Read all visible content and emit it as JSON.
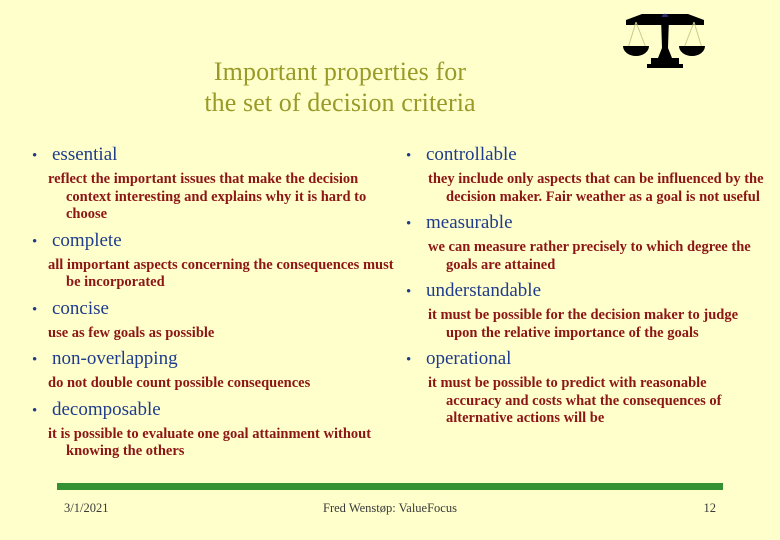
{
  "slide": {
    "background_color": "#ffffcc",
    "title_color": "#9a9a29",
    "heading_color": "#1f3c8c",
    "subtext_color": "#8c1616",
    "rule_color": "#339133",
    "title_line_1": "Important properties for",
    "title_line_2": "the set of decision criteria"
  },
  "icon": {
    "name": "balance-scale-icon",
    "color": "#000000"
  },
  "left_column": [
    {
      "label": "essential",
      "detail": "reflect the important issues that make the decision context interesting and explains why it is hard to choose"
    },
    {
      "label": "complete",
      "detail": "all important aspects concerning the consequences must be incorporated"
    },
    {
      "label": "concise",
      "detail": "use as few goals as possible"
    },
    {
      "label": "non-overlapping",
      "detail": "do not double count possible consequences"
    },
    {
      "label": "decomposable",
      "detail": "it is possible to evaluate one goal attainment without knowing the others"
    }
  ],
  "right_column": [
    {
      "label": "controllable",
      "detail": "they include only aspects that can be influenced by the decision maker. Fair weather as a goal is not useful"
    },
    {
      "label": "measurable",
      "detail": "we can measure rather precisely to which degree the goals are attained"
    },
    {
      "label": "understandable",
      "detail": "it must be possible for the decision maker to judge upon the relative importance of the goals"
    },
    {
      "label": "operational",
      "detail": "it must be possible to predict with reasonable accuracy and costs what the consequences of alternative actions will be"
    }
  ],
  "footer": {
    "date": "3/1/2021",
    "center": "Fred Wenstøp: ValueFocus",
    "page_number": "12"
  },
  "bullet_glyph": "•"
}
